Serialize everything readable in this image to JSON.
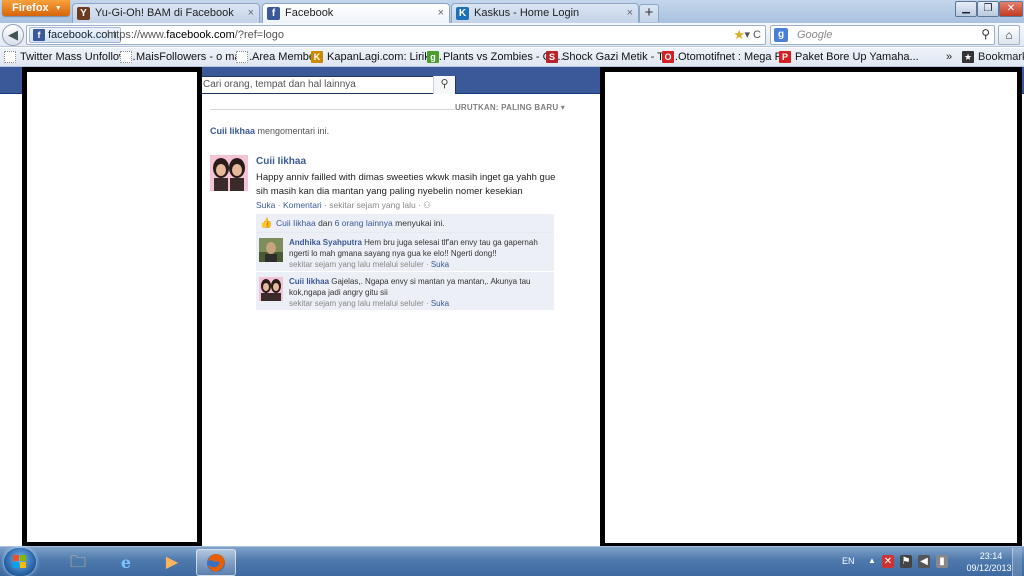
{
  "browser": {
    "menu_button": "Firefox",
    "tabs": [
      {
        "label": "Yu-Gi-Oh! BAM di Facebook",
        "active": false
      },
      {
        "label": "Facebook",
        "active": true
      },
      {
        "label": "Kaskus - Home Login",
        "active": false
      }
    ],
    "new_tab": "+",
    "identity": "facebook.com",
    "url_prefix": "https://www.",
    "url_domain": "facebook.com",
    "url_suffix": "/?ref=logo",
    "search_placeholder": "Google",
    "bookmarks": [
      "Twitter Mass Unfollow...",
      "MaisFollowers - o mai...",
      "Area Member",
      "KapanLagi.com: Lirik ...",
      "Plants vs Zombies - Ga...",
      "Shock Gazi Metik - To...",
      "Otomotifnet : Mega P...",
      "Paket Bore Up Yamaha..."
    ],
    "bookmarks_more": "»",
    "bookmarks_menu": "Bookmarks"
  },
  "facebook": {
    "search_placeholder": "Cari orang, tempat dan hal lainnya",
    "sort_label": "URUTKAN: PALING BARU",
    "notice_name": "Cuii Iikhaa",
    "notice_text": "mengomentari ini.",
    "post": {
      "author": "Cuii Iikhaa",
      "text": "Happy anniv failled with dimas sweeties wkwk masih inget ga yahh gue sih masih kan dia mantan yang paling nyebelin nomer kesekian",
      "like_action": "Suka",
      "comment_action": "Komentari",
      "time": "sekitar sejam yang lalu",
      "likes_name": "Cuii Iikhaa",
      "likes_connector": "dan",
      "likes_others": "6 orang lainnya",
      "likes_suffix": "menyukai ini."
    },
    "comments": [
      {
        "author": "Andhika Syahputra",
        "text": "Hem bru juga selesai tlf'an envy tau ga gapernah ngerti lo mah gmana sayang nya gua ke elo!! Ngerti dong!!",
        "meta": "sekitar sejam yang lalu melalui seluler",
        "like": "Suka"
      },
      {
        "author": "Cuii Iikhaa",
        "text": "Gajelas,. Ngapa envy si mantan ya mantan,. Akunya tau kok,ngapa jadi angry gitu sii",
        "meta": "sekitar sejam yang lalu melalui seluler",
        "like": "Suka"
      }
    ]
  },
  "taskbar": {
    "language": "EN",
    "time": "23:14",
    "date": "09/12/2013"
  },
  "colors": {
    "facebook_blue": "#3b5998",
    "firefox_orange": "#e66000",
    "taskbar_blue": "#4e79ad"
  }
}
